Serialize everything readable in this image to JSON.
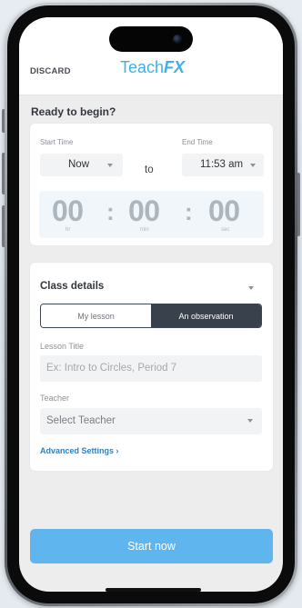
{
  "header": {
    "discard_label": "DISCARD",
    "logo_part1": "Teach",
    "logo_part2": "FX"
  },
  "main": {
    "heading": "Ready to begin?"
  },
  "time": {
    "start_label": "Start Time",
    "start_value": "Now",
    "to_label": "to",
    "end_label": "End Time",
    "end_value": "11:53 am",
    "timer": {
      "hours": "00",
      "minutes": "00",
      "seconds": "00",
      "separator": ":",
      "hours_unit": "hr",
      "minutes_unit": "min",
      "seconds_unit": "sec"
    }
  },
  "class_details": {
    "title": "Class details",
    "tabs": [
      {
        "label": "My lesson",
        "selected": false
      },
      {
        "label": "An observation",
        "selected": true
      }
    ],
    "lesson_title_label": "Lesson Title",
    "lesson_title_placeholder": "Ex: Intro to Circles, Period 7",
    "teacher_label": "Teacher",
    "teacher_value": "Select Teacher",
    "advanced_label": "Advanced Settings ›"
  },
  "footer": {
    "start_label": "Start now"
  },
  "colors": {
    "brand": "#3fb0e6",
    "primary_button": "#5fb6ee",
    "segment_selected": "#39424c",
    "link": "#2f7fc0"
  }
}
